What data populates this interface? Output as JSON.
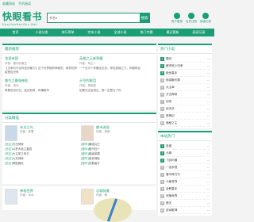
{
  "topbar": {
    "links": [
      "收藏网站",
      "手机阅读"
    ]
  },
  "logo": {
    "title": "快眼看书",
    "subtitle": "KuaiYanKanShu.Net"
  },
  "search": {
    "select": "书名",
    "placeholder": "",
    "button": "搜索"
  },
  "header_icons": [
    "用户登录",
    "会员注册",
    "阅读记录"
  ],
  "nav": [
    "首页",
    "小说分类",
    "排行榜单",
    "完本小说",
    "全部小说",
    "热门专题",
    "最近更新",
    "阅读记录"
  ],
  "featured": {
    "title": "最新推荐",
    "books": [
      {
        "name": "龙皇帝国",
        "author": "作者：雪中的霸王",
        "desc": "【文明与不合时宜的暴力】这个世界拥有神秘的，奇异的异能冒险世界"
      },
      {
        "name": "英雄之王者荣耀",
        "author": "作者：鸡之一",
        "desc": "一个天才少年横空出世，掌控英雄之力，称霸峡谷"
      },
      {
        "name": "重生之最强神医",
        "author": "作者：流光",
        "desc": "带着前世记忆，医武双修，纵横都市"
      },
      {
        "name": "天空的眼泪",
        "author": "作者：风雨若",
        "desc": "如果天空会哭泣，那一定是为了你"
      }
    ]
  },
  "category": {
    "title": "分类精选",
    "cols": [
      {
        "name": "东方之光",
        "author": "作者：赤雪",
        "items": [
          [
            "[玄幻]",
            "万古神帝"
          ],
          [
            "[玄幻]",
            "斗罗大陆之星辰"
          ],
          [
            "[玄幻]",
            "大主宰之帝王"
          ],
          [
            "[玄幻]",
            "九天神帝"
          ],
          [
            "[玄幻]",
            "神医嫡女"
          ]
        ]
      },
      {
        "name": "都市逍遥",
        "author": "作者：夜雨",
        "items": [
          [
            "[都市]",
            "最强兵王"
          ],
          [
            "[都市]",
            "都市狂少"
          ],
          [
            "[都市]",
            "超级保镖"
          ],
          [
            "[都市]",
            "绝世神医"
          ],
          [
            "[都市]",
            "花都高手"
          ]
        ]
      }
    ]
  },
  "category2": {
    "cols": [
      {
        "name": "神秘世界",
        "author": "作者：木木",
        "items": [
          [
            "[仙侠]",
            "星辰变"
          ],
          [
            "[仙侠]",
            "凡人修仙传"
          ]
        ]
      },
      {
        "name": "总裁前妻",
        "author": "作者：萌",
        "items": [
          [
            "[言情]",
            "霸道总裁爱上我"
          ],
          [
            "[言情]",
            "前妻来袭"
          ]
        ]
      }
    ]
  },
  "rank1": {
    "title": "热门小说",
    "items": [
      [
        "1",
        "霸剑",
        "—"
      ],
      [
        "2",
        "都市狂少归来",
        "—"
      ],
      [
        "3",
        "绝世高手",
        "—"
      ],
      [
        "4",
        "修真聊天群",
        "—"
      ],
      [
        "5",
        "大主宰",
        "—"
      ],
      [
        "6",
        "万古神帝",
        "—"
      ],
      [
        "7",
        "剑来",
        "—"
      ],
      [
        "8",
        "伏天氏",
        "—"
      ],
      [
        "9",
        "牧神记",
        "—"
      ],
      [
        "10",
        "诡秘之主",
        "—"
      ]
    ]
  },
  "rank2": {
    "title": "本站热门",
    "items": [
      [
        "1",
        "圣墟",
        "—"
      ],
      [
        "2",
        "元尊",
        "—"
      ],
      [
        "3",
        "飞剑问道",
        "—"
      ],
      [
        "4",
        "一念永恒",
        "—"
      ],
      [
        "5",
        "雪中悍刀行",
        "—"
      ],
      [
        "6",
        "斗破苍穹",
        "—"
      ],
      [
        "7",
        "全职高手",
        "—"
      ],
      [
        "8",
        "完美世界",
        "—"
      ],
      [
        "9",
        "遮天",
        "—"
      ],
      [
        "10",
        "武动乾坤",
        "—"
      ]
    ]
  }
}
